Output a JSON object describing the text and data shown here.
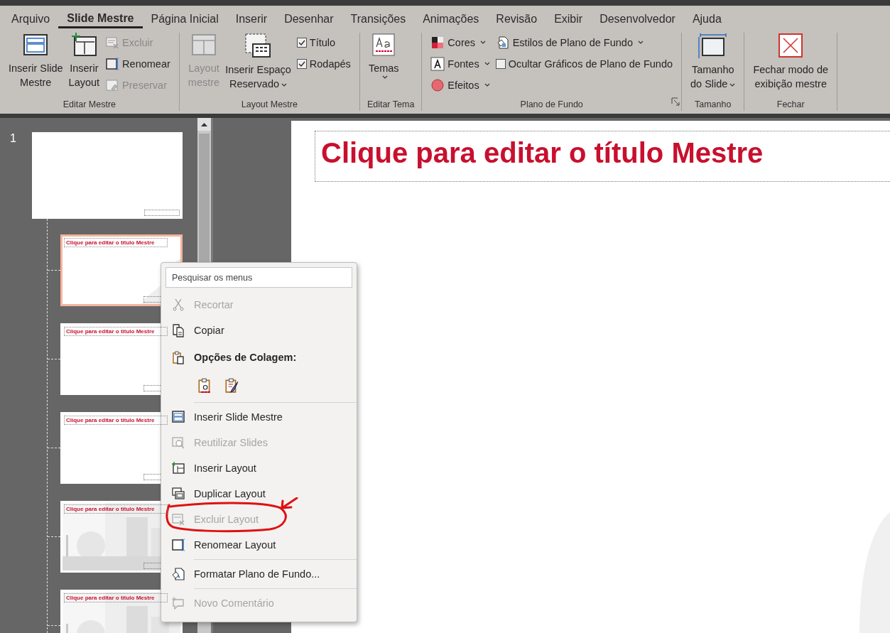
{
  "tabs": [
    {
      "label": "Arquivo",
      "selected": false
    },
    {
      "label": "Slide Mestre",
      "selected": true
    },
    {
      "label": "Página Inicial",
      "selected": false
    },
    {
      "label": "Inserir",
      "selected": false
    },
    {
      "label": "Desenhar",
      "selected": false
    },
    {
      "label": "Transições",
      "selected": false
    },
    {
      "label": "Animações",
      "selected": false
    },
    {
      "label": "Revisão",
      "selected": false
    },
    {
      "label": "Exibir",
      "selected": false
    },
    {
      "label": "Desenvolvedor",
      "selected": false
    },
    {
      "label": "Ajuda",
      "selected": false
    }
  ],
  "ribbon": {
    "groups": [
      {
        "label": "Editar Mestre",
        "launcher": false,
        "columns": [
          {
            "items": [
              {
                "kind": "large",
                "lines": [
                  "Inserir Slide",
                  "Mestre"
                ],
                "disabled": false,
                "dropdown": false
              }
            ]
          },
          {
            "items": [
              {
                "kind": "large",
                "lines": [
                  "Inserir",
                  "Layout"
                ],
                "disabled": false,
                "dropdown": false
              }
            ]
          },
          {
            "items": [
              {
                "kind": "small",
                "label": "Excluir",
                "disabled": true,
                "dropdown": false
              },
              {
                "kind": "small",
                "label": "Renomear",
                "disabled": false,
                "dropdown": false
              },
              {
                "kind": "small",
                "label": "Preservar",
                "disabled": true,
                "dropdown": false
              }
            ]
          }
        ]
      },
      {
        "label": "Layout Mestre",
        "launcher": false,
        "columns": [
          {
            "items": [
              {
                "kind": "large",
                "lines": [
                  "Layout",
                  "mestre"
                ],
                "disabled": true,
                "dropdown": false
              }
            ]
          },
          {
            "items": [
              {
                "kind": "large",
                "lines": [
                  "Inserir Espaço",
                  "Reservado"
                ],
                "disabled": false,
                "dropdown": true
              }
            ]
          },
          {
            "items": [
              {
                "kind": "check",
                "label": "Título",
                "checked": true,
                "disabled": false,
                "dropdown": false
              },
              {
                "kind": "check",
                "label": "Rodapés",
                "checked": true,
                "disabled": false,
                "dropdown": false
              }
            ]
          }
        ]
      },
      {
        "label": "Editar Tema",
        "launcher": false,
        "columns": [
          {
            "items": [
              {
                "kind": "large",
                "lines": [
                  "Temas"
                ],
                "disabled": false,
                "dropdown": true
              }
            ]
          }
        ]
      },
      {
        "label": "Plano de Fundo",
        "launcher": true,
        "columns": [
          {
            "items": [
              {
                "kind": "small",
                "label": "Cores",
                "disabled": false,
                "dropdown": true
              },
              {
                "kind": "small",
                "label": "Fontes",
                "disabled": false,
                "dropdown": true
              },
              {
                "kind": "small",
                "label": "Efeitos",
                "disabled": false,
                "dropdown": true
              }
            ]
          },
          {
            "items": [
              {
                "kind": "small",
                "label": "Estilos de Plano de Fundo",
                "disabled": false,
                "dropdown": true
              },
              {
                "kind": "check",
                "label": "Ocultar Gráficos de Plano de Fundo",
                "checked": false,
                "disabled": false,
                "dropdown": false
              }
            ]
          }
        ]
      },
      {
        "label": "Tamanho",
        "launcher": false,
        "columns": [
          {
            "items": [
              {
                "kind": "large",
                "lines": [
                  "Tamanho",
                  "do Slide"
                ],
                "disabled": false,
                "dropdown": true
              }
            ]
          }
        ]
      },
      {
        "label": "Fechar",
        "launcher": false,
        "columns": [
          {
            "items": [
              {
                "kind": "large",
                "lines": [
                  "Fechar modo de",
                  "exibição mestre"
                ],
                "disabled": false,
                "dropdown": false
              }
            ]
          }
        ]
      }
    ]
  },
  "slide_pane": {
    "master": {
      "number": "1",
      "selected": false
    },
    "layouts": [
      {
        "kind": "shape",
        "title": "Clique para editar o título Mestre",
        "selected": true
      },
      {
        "kind": "blank",
        "title": "Clique para editar o título Mestre",
        "selected": false
      },
      {
        "kind": "blank",
        "title": "Clique para editar o título Mestre",
        "selected": false
      },
      {
        "kind": "picture",
        "title": "Clique para editar o título Mestre",
        "selected": false
      },
      {
        "kind": "picture",
        "title": "Clique para editar o título Mestre",
        "selected": false
      }
    ]
  },
  "slide": {
    "title": "Clique para editar o título Mestre"
  },
  "context_menu": {
    "search": {
      "placeholder": "Pesquisar os menus"
    },
    "items": [
      {
        "kind": "item",
        "label": "Recortar",
        "disabled": true
      },
      {
        "kind": "item",
        "label": "Copiar",
        "disabled": false
      },
      {
        "kind": "header",
        "label": "Opções de Colagem:"
      },
      {
        "kind": "paste-options"
      },
      {
        "kind": "separator"
      },
      {
        "kind": "item",
        "label": "Inserir Slide Mestre",
        "disabled": false
      },
      {
        "kind": "item",
        "label": "Reutilizar Slides",
        "disabled": true
      },
      {
        "kind": "item",
        "label": "Inserir Layout",
        "disabled": false
      },
      {
        "kind": "item",
        "label": "Duplicar Layout",
        "disabled": false
      },
      {
        "kind": "item",
        "label": "Excluir Layout",
        "disabled": true
      },
      {
        "kind": "item",
        "label": "Renomear Layout",
        "disabled": false
      },
      {
        "kind": "separator"
      },
      {
        "kind": "item",
        "label": "Formatar Plano de Fundo...",
        "disabled": false
      },
      {
        "kind": "separator"
      },
      {
        "kind": "item",
        "label": "Novo Comentário",
        "disabled": true
      }
    ]
  }
}
